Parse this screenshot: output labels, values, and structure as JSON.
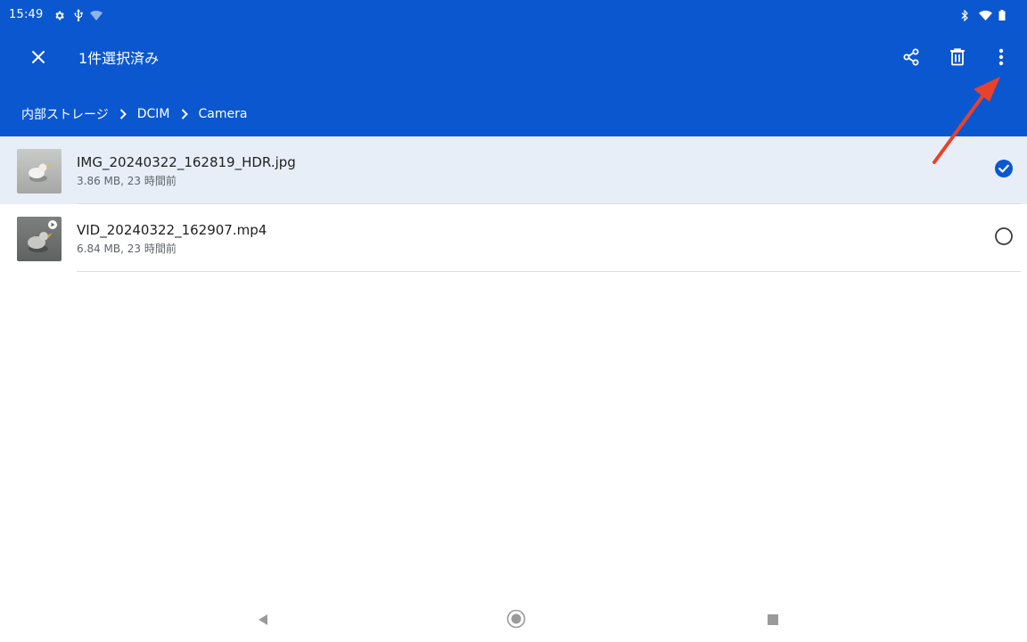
{
  "status_bar": {
    "time": "15:49"
  },
  "action_bar": {
    "title": "1件選択済み"
  },
  "breadcrumb": [
    "内部ストレージ",
    "DCIM",
    "Camera"
  ],
  "files": [
    {
      "name": "IMG_20240322_162819_HDR.jpg",
      "meta": "3.86 MB, 23 時間前",
      "selected": true
    },
    {
      "name": "VID_20240322_162907.mp4",
      "meta": "6.84 MB, 23 時間前",
      "selected": false
    }
  ],
  "icons": {
    "close": "close-icon",
    "share": "share-icon",
    "delete": "delete-icon",
    "more": "more-vert-icon"
  },
  "colors": {
    "header_bg": "#0b57d0",
    "selected_row_bg": "#e8eef8",
    "check": "#0b57d0",
    "annotation_arrow": "#e8412c"
  }
}
